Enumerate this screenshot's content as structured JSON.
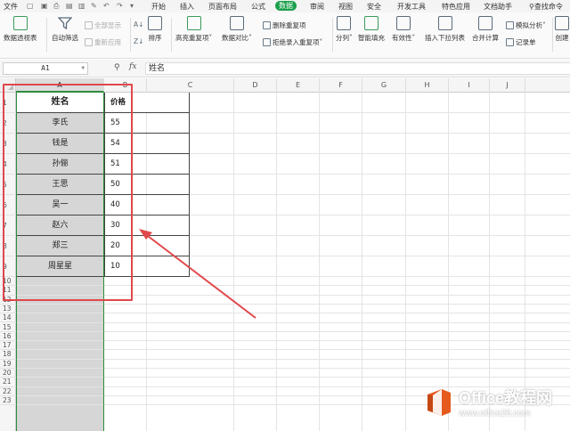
{
  "menu": {
    "file": "文件",
    "tabs": [
      "开始",
      "插入",
      "页面布局",
      "公式",
      "数据",
      "审阅",
      "视图",
      "安全",
      "开发工具",
      "特色应用",
      "文档助手"
    ],
    "active_tab": "数据",
    "search": "查找命令"
  },
  "ribbon": {
    "pivot": "数据透视表",
    "autofilter": "自动筛选",
    "show_all": "全部显示",
    "reapply": "重新应用",
    "sort": "排序",
    "highlight_dup": "高亮重复项",
    "compare": "数据对比",
    "remove_dup": "删除重复项",
    "reject_dup": "拒绝录入重复项",
    "split": "分列",
    "smart_fill": "智能填充",
    "validity": "有效性",
    "insert_dropdown": "插入下拉列表",
    "consolidate": "合并计算",
    "simulate": "模拟分析",
    "record": "记录单",
    "create_group": "创建"
  },
  "formula_bar": {
    "name_box": "A1",
    "fx": "fx",
    "content": "姓名"
  },
  "columns": [
    "A",
    "B",
    "C",
    "D",
    "E",
    "F",
    "G",
    "H",
    "I",
    "J"
  ],
  "rows": [
    "1",
    "2",
    "3",
    "4",
    "5",
    "6",
    "7",
    "8",
    "9",
    "10",
    "11",
    "12",
    "13",
    "14",
    "15",
    "16",
    "17",
    "18",
    "19",
    "20",
    "21",
    "22",
    "23"
  ],
  "table": {
    "header_name": "姓名",
    "header_price": "价格",
    "rows": [
      {
        "name": "李氏",
        "price": "55"
      },
      {
        "name": "钱是",
        "price": "54"
      },
      {
        "name": "孙俪",
        "price": "51"
      },
      {
        "name": "王思",
        "price": "50"
      },
      {
        "name": "吴一",
        "price": "40"
      },
      {
        "name": "赵六",
        "price": "30"
      },
      {
        "name": "郑三",
        "price": "20"
      },
      {
        "name": "周星星",
        "price": "10"
      }
    ]
  },
  "watermark": {
    "title": "Office教程网",
    "url": "www.office26.com"
  },
  "colors": {
    "accent": "#1a9f4a",
    "selection": "#2e8b3e",
    "annotation": "#e0484b"
  }
}
